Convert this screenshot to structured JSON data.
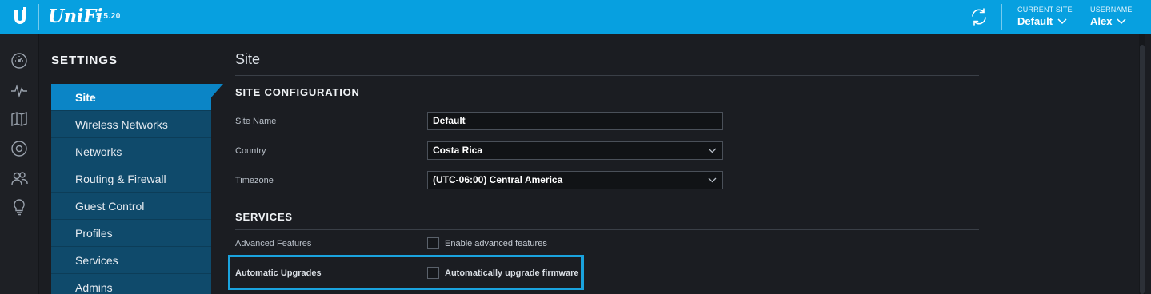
{
  "topbar": {
    "brand": "UniFi",
    "version": "5.5.20",
    "current_site_label": "CURRENT SITE",
    "current_site_value": "Default",
    "username_label": "USERNAME",
    "username_value": "Alex",
    "accent_color": "#07a0e0"
  },
  "rail": {
    "icons": [
      "dashboard-icon",
      "statistics-icon",
      "map-icon",
      "devices-icon",
      "clients-icon",
      "insights-icon"
    ]
  },
  "sidebar": {
    "title": "SETTINGS",
    "items": [
      {
        "label": "Site",
        "active": true
      },
      {
        "label": "Wireless Networks",
        "active": false
      },
      {
        "label": "Networks",
        "active": false
      },
      {
        "label": "Routing & Firewall",
        "active": false
      },
      {
        "label": "Guest Control",
        "active": false
      },
      {
        "label": "Profiles",
        "active": false
      },
      {
        "label": "Services",
        "active": false
      },
      {
        "label": "Admins",
        "active": false
      }
    ]
  },
  "main": {
    "page_title": "Site",
    "site_config": {
      "title": "SITE CONFIGURATION",
      "site_name_label": "Site Name",
      "site_name_value": "Default",
      "country_label": "Country",
      "country_value": "Costa Rica",
      "timezone_label": "Timezone",
      "timezone_value": "(UTC-06:00) Central America"
    },
    "services": {
      "title": "SERVICES",
      "advanced_label": "Advanced Features",
      "advanced_checkbox_label": "Enable advanced features",
      "advanced_checked": false,
      "auto_upgrade_label": "Automatic Upgrades",
      "auto_upgrade_checkbox_label": "Automatically upgrade firmware",
      "auto_upgrade_checked": false
    }
  }
}
